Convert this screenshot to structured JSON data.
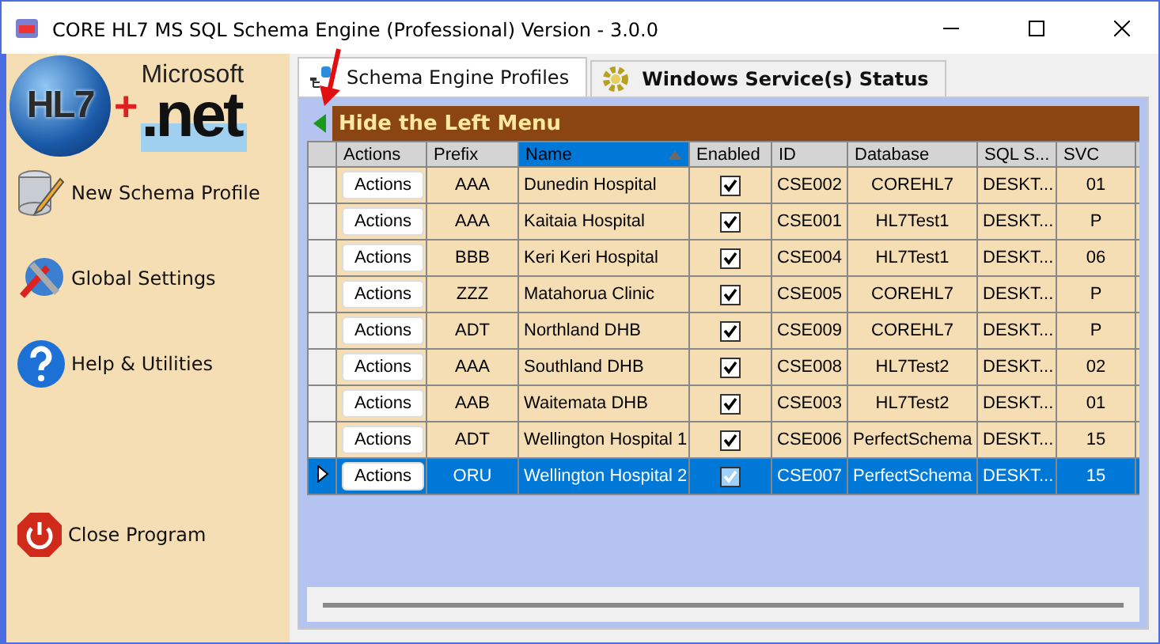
{
  "window": {
    "title": "CORE HL7 MS SQL Schema Engine (Professional) Version - 3.0.0"
  },
  "logo": {
    "left": "HL7",
    "plus": "+",
    "brand": "Microsoft",
    "right": ".net"
  },
  "sidebar": {
    "items": [
      {
        "label": "New Schema Profile",
        "kind": "database"
      },
      {
        "label": "Global Settings",
        "kind": "tools"
      },
      {
        "label": "Help & Utilities",
        "kind": "help"
      },
      {
        "label": "Close Program",
        "kind": "power"
      }
    ]
  },
  "tabs": [
    {
      "label": "Schema Engine Profiles",
      "kind": "database",
      "selected": true
    },
    {
      "label": "Windows Service(s) Status",
      "kind": "gear",
      "selected": false
    }
  ],
  "panel": {
    "header": "Hide the Left Menu"
  },
  "table": {
    "columns": [
      {
        "label": "Actions",
        "sorted": false
      },
      {
        "label": "Prefix",
        "sorted": false
      },
      {
        "label": "Name",
        "sorted": true
      },
      {
        "label": "Enabled",
        "sorted": false
      },
      {
        "label": "ID",
        "sorted": false
      },
      {
        "label": "Database",
        "sorted": false
      },
      {
        "label": "SQL S...",
        "sorted": false
      },
      {
        "label": "SVC",
        "sorted": false
      }
    ],
    "rows": [
      {
        "action": "Actions",
        "prefix": "AAA",
        "name": "Dunedin Hospital",
        "enabled": true,
        "id": "CSE002",
        "database": "COREHL7",
        "sql_server": "DESKT...",
        "svc": "01",
        "selected": false
      },
      {
        "action": "Actions",
        "prefix": "AAA",
        "name": "Kaitaia Hospital",
        "enabled": true,
        "id": "CSE001",
        "database": "HL7Test1",
        "sql_server": "DESKT...",
        "svc": "P",
        "selected": false
      },
      {
        "action": "Actions",
        "prefix": "BBB",
        "name": "Keri Keri Hospital",
        "enabled": true,
        "id": "CSE004",
        "database": "HL7Test1",
        "sql_server": "DESKT...",
        "svc": "06",
        "selected": false
      },
      {
        "action": "Actions",
        "prefix": "ZZZ",
        "name": "Matahorua Clinic",
        "enabled": true,
        "id": "CSE005",
        "database": "COREHL7",
        "sql_server": "DESKT...",
        "svc": "P",
        "selected": false
      },
      {
        "action": "Actions",
        "prefix": "ADT",
        "name": "Northland DHB",
        "enabled": true,
        "id": "CSE009",
        "database": "COREHL7",
        "sql_server": "DESKT...",
        "svc": "P",
        "selected": false
      },
      {
        "action": "Actions",
        "prefix": "AAA",
        "name": "Southland DHB",
        "enabled": true,
        "id": "CSE008",
        "database": "HL7Test2",
        "sql_server": "DESKT...",
        "svc": "02",
        "selected": false
      },
      {
        "action": "Actions",
        "prefix": "AAB",
        "name": "Waitemata DHB",
        "enabled": true,
        "id": "CSE003",
        "database": "HL7Test2",
        "sql_server": "DESKT...",
        "svc": "01",
        "selected": false
      },
      {
        "action": "Actions",
        "prefix": "ADT",
        "name": "Wellington Hospital 1",
        "enabled": true,
        "id": "CSE006",
        "database": "PerfectSchema",
        "sql_server": "DESKT...",
        "svc": "15",
        "selected": false
      },
      {
        "action": "Actions",
        "prefix": "ORU",
        "name": "Wellington Hospital 2",
        "enabled": true,
        "id": "CSE007",
        "database": "PerfectSchema",
        "sql_server": "DESKT...",
        "svc": "15",
        "selected": true
      }
    ]
  }
}
